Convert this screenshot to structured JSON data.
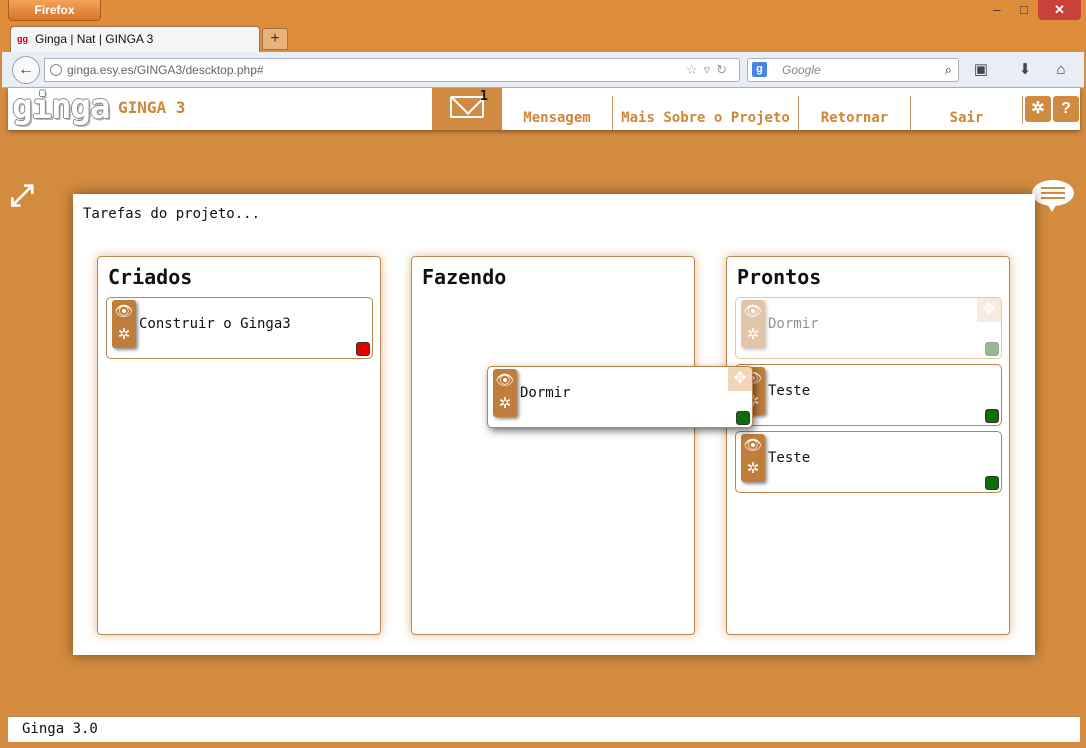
{
  "browser": {
    "menu_label": "Firefox",
    "tab_title": "Ginga | Nat | GINGA 3",
    "favicon_text": "gg",
    "new_tab_label": "+",
    "url": "ginga.esy.es/GINGA3/descktop.php#",
    "search_placeholder": "Google",
    "window_controls": {
      "minimize": "–",
      "maximize": "□",
      "close": "✕"
    }
  },
  "header": {
    "logo_text": "ginga",
    "app_title": "GINGA 3",
    "message_count": "1",
    "nav": {
      "mensagem": "Mensagem",
      "mais_sobre": "Mais Sobre o Projeto",
      "retornar": "Retornar",
      "sair": "Sair"
    },
    "icons": {
      "settings": "gear-icon",
      "help": "help-icon",
      "mail": "mail-icon"
    }
  },
  "panel": {
    "caption": "Tarefas do projeto...",
    "columns": [
      {
        "title": "Criados",
        "cards": [
          {
            "text": "Construir o Ginga3",
            "status_color": "#e00000"
          }
        ]
      },
      {
        "title": "Fazendo",
        "cards": []
      },
      {
        "title": "Prontos",
        "cards": [
          {
            "text": "Dormir",
            "status_color": "#0a6e0a",
            "state": "placeholder"
          },
          {
            "text": "Teste",
            "status_color": "#0a6e0a"
          },
          {
            "text": "Teste",
            "status_color": "#0a6e0a"
          }
        ]
      }
    ],
    "dragged_card": {
      "text": "Dormir",
      "status_color": "#0a6e0a"
    }
  },
  "footer": {
    "text": "Ginga 3.0"
  },
  "colors": {
    "accent": "#d08638",
    "background": "#d38b3f",
    "card_border": "#b98450"
  }
}
